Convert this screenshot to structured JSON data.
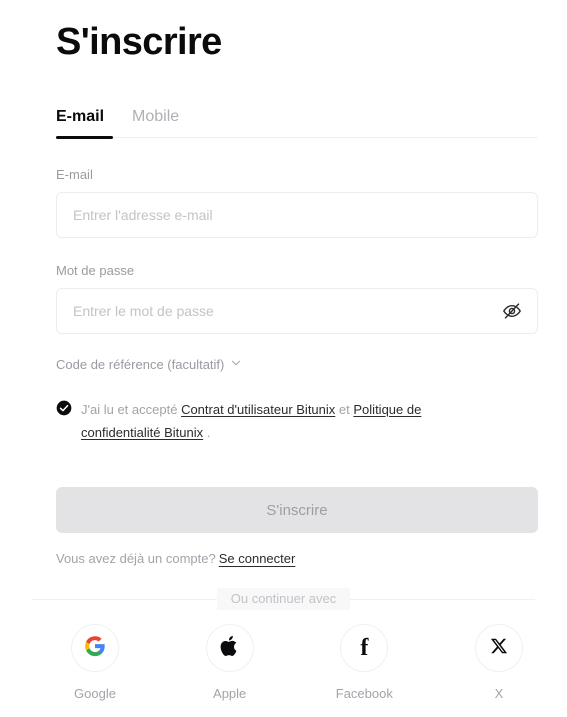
{
  "page": {
    "title": "S'inscrire"
  },
  "tabs": [
    {
      "label": "E-mail",
      "active": true
    },
    {
      "label": "Mobile",
      "active": false
    }
  ],
  "form": {
    "email": {
      "label": "E-mail",
      "placeholder": "Entrer l'adresse e-mail",
      "value": ""
    },
    "password": {
      "label": "Mot de passe",
      "placeholder": "Entrer le mot de passe",
      "value": "",
      "toggle_icon": "eye-off-icon"
    },
    "referral": {
      "label": "Code de référence (facultatif)",
      "icon": "chevron-down-icon"
    },
    "agreement": {
      "checked": true,
      "checkbox_icon": "check-circle-filled-icon",
      "prefix": "J'ai lu et accepté",
      "link1": "Contrat d'utilisateur Bitunix",
      "conjunction": "et",
      "link2": "Politique de confidentialité Bitunix",
      "suffix": "."
    },
    "submit_label": "S'inscrire"
  },
  "login_prompt": {
    "text": "Vous avez déjà un compte?",
    "link": "Se connecter"
  },
  "divider": {
    "text": "Ou continuer avec"
  },
  "socials": [
    {
      "label": "Google",
      "icon": "google-icon"
    },
    {
      "label": "Apple",
      "icon": "apple-icon"
    },
    {
      "label": "Facebook",
      "icon": "facebook-icon"
    },
    {
      "label": "X",
      "icon": "x-twitter-icon"
    }
  ],
  "colors": {
    "accent": "#0b0b0d",
    "muted_text": "#a3a3aa",
    "border": "#ececed",
    "button_disabled_bg": "#e3e3e5",
    "button_disabled_text": "#9d9da4",
    "google_blue": "#4285F4",
    "google_green": "#34A853",
    "google_yellow": "#FBBC05",
    "google_red": "#EA4335"
  }
}
